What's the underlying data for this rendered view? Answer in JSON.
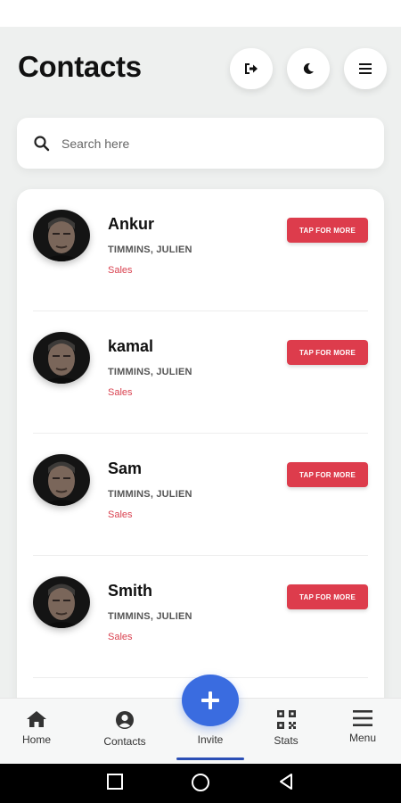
{
  "header": {
    "title": "Contacts",
    "buttons": [
      {
        "icon": "logout-icon"
      },
      {
        "icon": "moon-icon"
      },
      {
        "icon": "menu-icon"
      }
    ]
  },
  "search": {
    "placeholder": "Search here",
    "value": "",
    "icon": "search-icon"
  },
  "contacts": [
    {
      "name": "Ankur",
      "subtitle": "TIMMINS, JULIEN",
      "department": "Sales",
      "action": "TAP FOR MORE"
    },
    {
      "name": "kamal",
      "subtitle": "TIMMINS, JULIEN",
      "department": "Sales",
      "action": "TAP FOR MORE"
    },
    {
      "name": "Sam",
      "subtitle": "TIMMINS, JULIEN",
      "department": "Sales",
      "action": "TAP FOR MORE"
    },
    {
      "name": "Smith",
      "subtitle": "TIMMINS, JULIEN",
      "department": "Sales",
      "action": "TAP FOR MORE"
    }
  ],
  "bottom_nav": {
    "items": [
      {
        "label": "Home",
        "icon": "home-icon"
      },
      {
        "label": "Contacts",
        "icon": "account-circle-icon"
      },
      {
        "label": "Invite",
        "icon": "plus-icon"
      },
      {
        "label": "Stats",
        "icon": "qr-code-icon"
      },
      {
        "label": "Menu",
        "icon": "menu-icon"
      }
    ],
    "active": "Invite"
  },
  "colors": {
    "accent_red": "#dd3c4c",
    "accent_blue": "#3a6ce0",
    "background": "#eef0ef"
  }
}
